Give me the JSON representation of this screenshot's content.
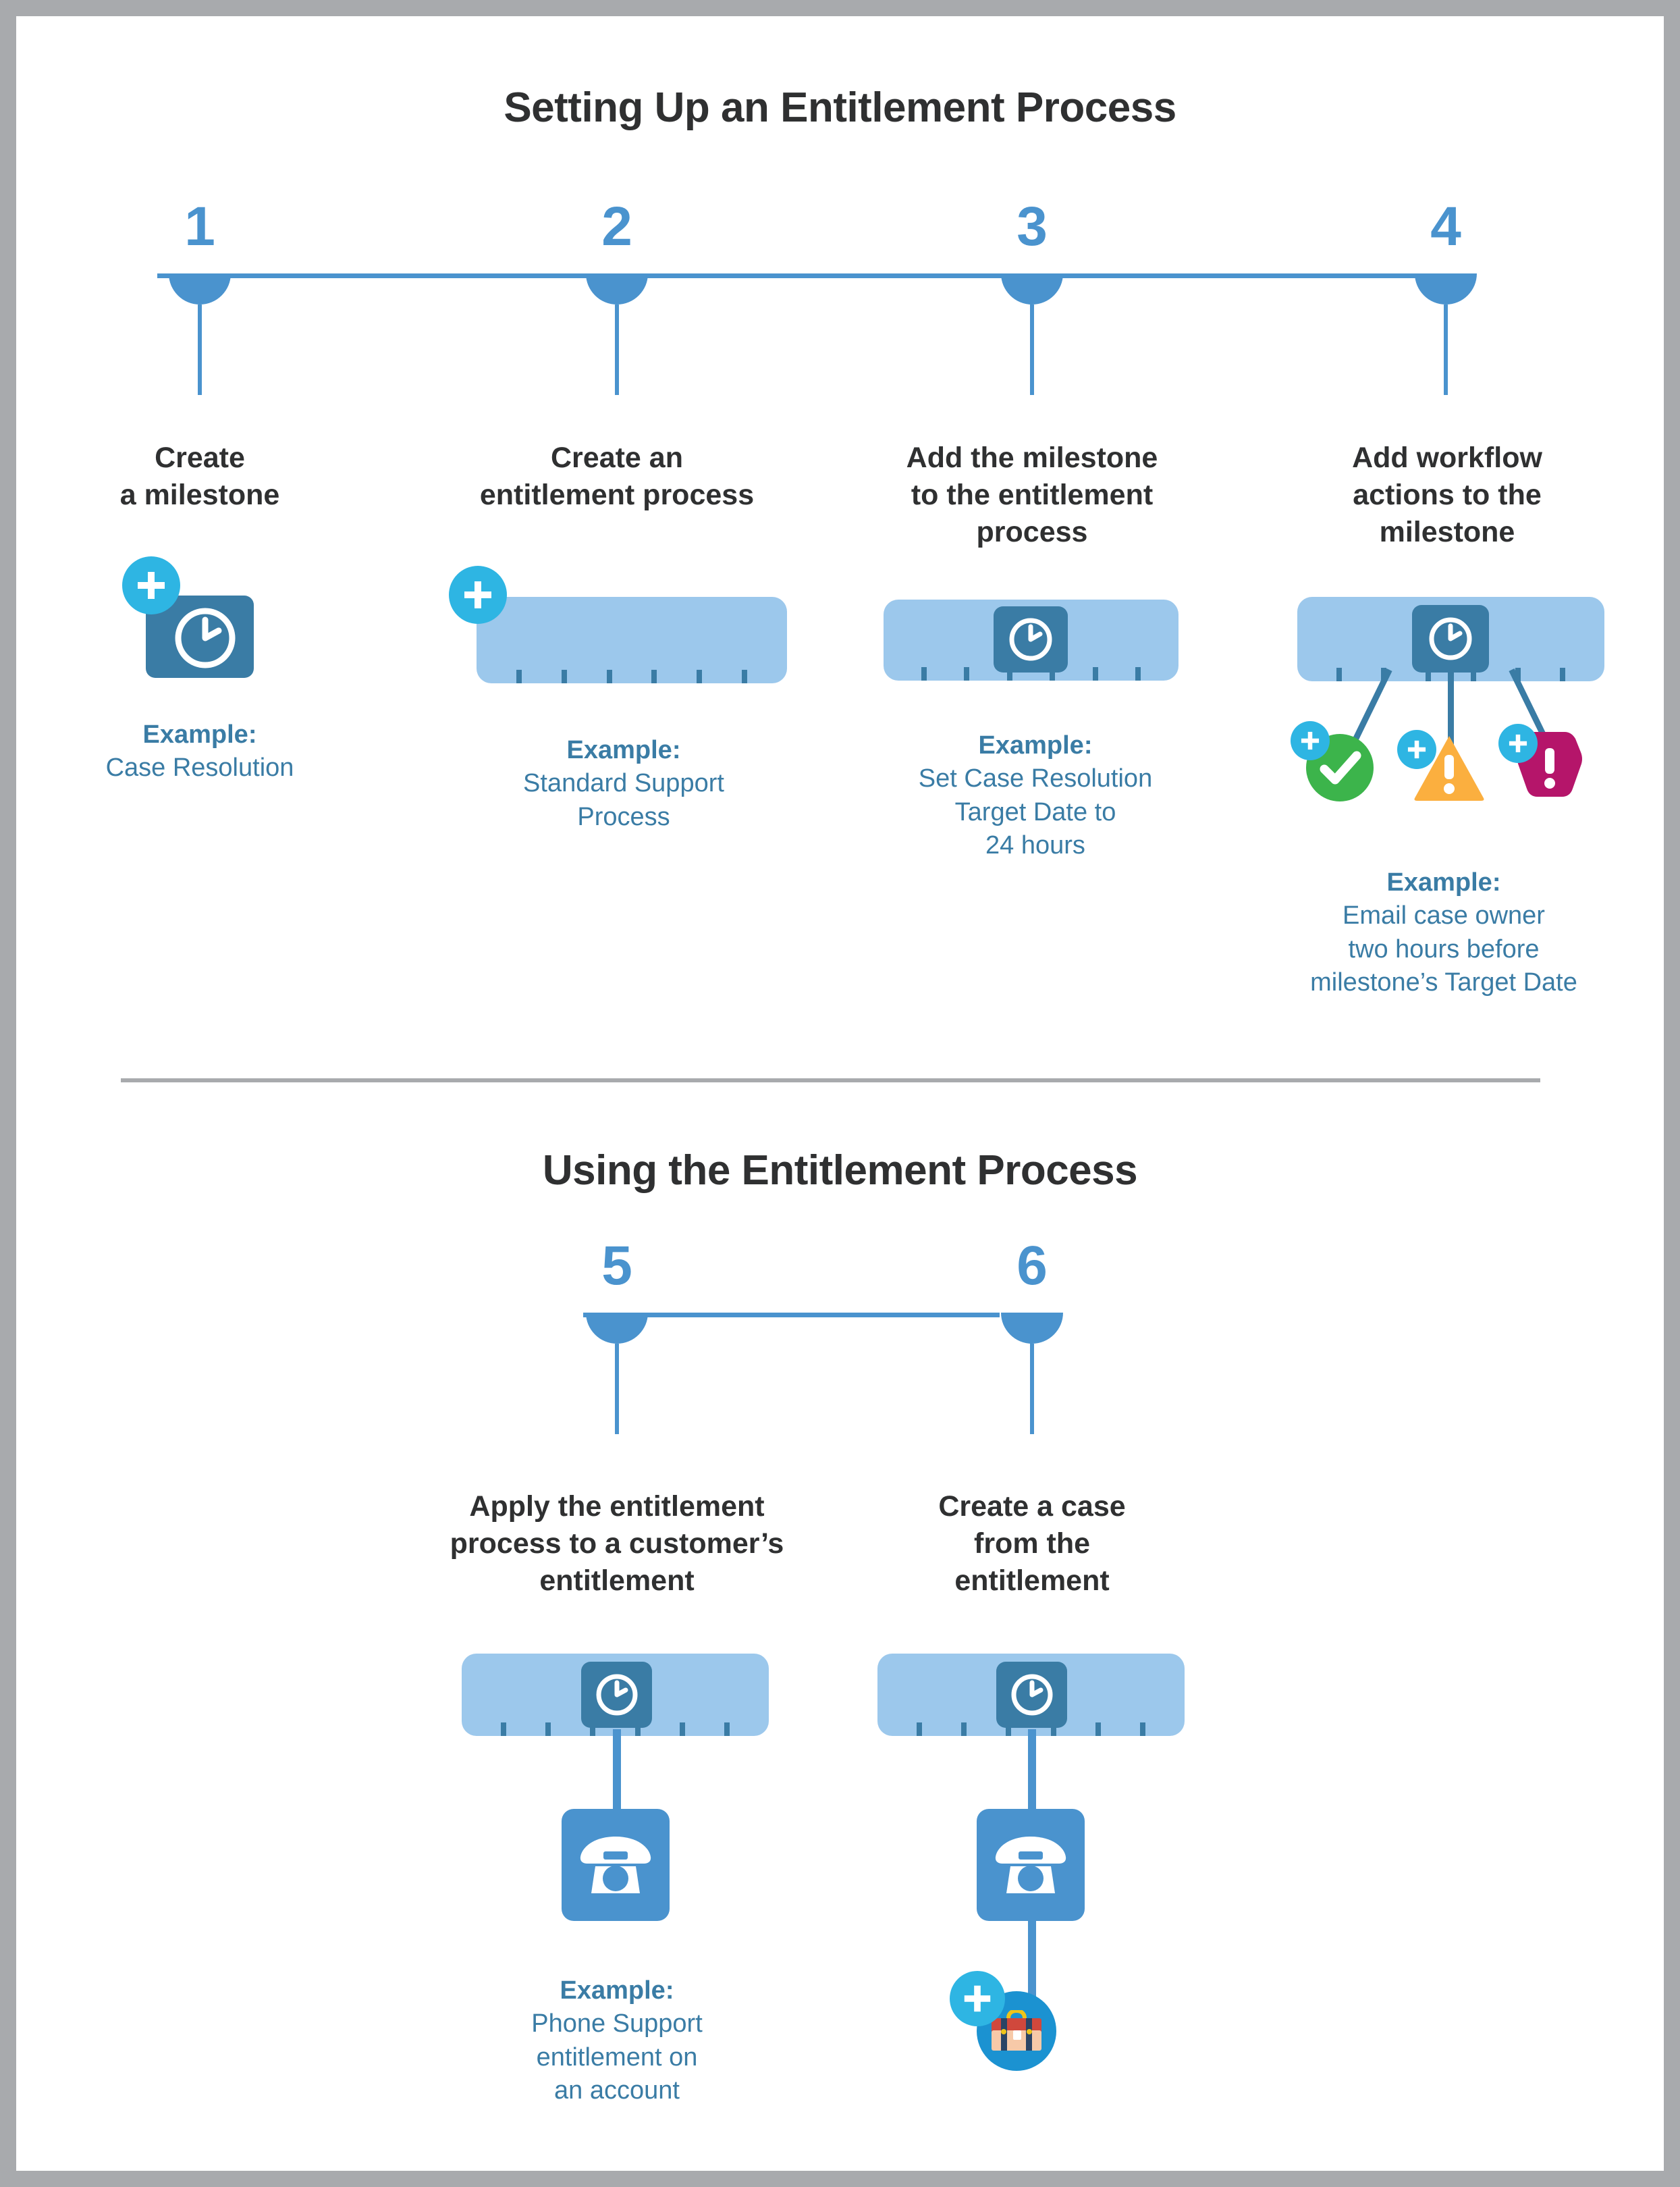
{
  "sections": [
    {
      "id": "setup",
      "title": "Setting Up an Entitlement Process"
    },
    {
      "id": "using",
      "title": "Using the Entitlement Process"
    }
  ],
  "steps": [
    {
      "number": "1",
      "heading": "Create\na milestone",
      "heading_lines": [
        "Create",
        "a milestone"
      ],
      "example_label": "Example:",
      "example_value": "Case Resolution",
      "example_value_lines": [
        "Case Resolution"
      ],
      "icons": [
        "plus-icon",
        "milestone-clock-icon"
      ]
    },
    {
      "number": "2",
      "heading": "Create an\nentitlement process",
      "heading_lines": [
        "Create an",
        "entitlement process"
      ],
      "example_label": "Example:",
      "example_value": "Standard Support Process",
      "example_value_lines": [
        "Standard Support",
        "Process"
      ],
      "icons": [
        "plus-icon",
        "entitlement-process-bar-icon"
      ]
    },
    {
      "number": "3",
      "heading": "Add the milestone\nto the entitlement\nprocess",
      "heading_lines": [
        "Add the milestone",
        "to the entitlement",
        "process"
      ],
      "example_label": "Example:",
      "example_value": "Set Case Resolution Target Date to 24 hours",
      "example_value_lines": [
        "Set Case Resolution",
        "Target Date to",
        "24 hours"
      ],
      "icons": [
        "entitlement-process-bar-icon",
        "milestone-clock-icon"
      ]
    },
    {
      "number": "4",
      "heading": "Add workflow\nactions to the\nmilestone",
      "heading_lines": [
        "Add workflow",
        "actions to the",
        "milestone"
      ],
      "example_label": "Example:",
      "example_value": "Email case owner two hours before milestone’s Target Date",
      "example_value_lines": [
        "Email case owner",
        "two hours before",
        "milestone’s Target Date"
      ],
      "icons": [
        "entitlement-process-bar-icon",
        "milestone-clock-icon",
        "success-check-icon",
        "warning-triangle-icon",
        "alert-hexagon-icon",
        "plus-icon"
      ]
    },
    {
      "number": "5",
      "heading": "Apply the entitlement\nprocess to a customer’s\nentitlement",
      "heading_lines": [
        "Apply the entitlement",
        "process to a customer’s",
        "entitlement"
      ],
      "example_label": "Example:",
      "example_value": "Phone Support entitlement on an account",
      "example_value_lines": [
        "Phone Support",
        "entitlement on",
        "an account"
      ],
      "icons": [
        "entitlement-process-bar-icon",
        "milestone-clock-icon",
        "phone-icon"
      ]
    },
    {
      "number": "6",
      "heading": "Create a case\nfrom the\nentitlement",
      "heading_lines": [
        "Create a case",
        "from the",
        "entitlement"
      ],
      "example_label": "",
      "example_value": "",
      "example_value_lines": [],
      "icons": [
        "entitlement-process-bar-icon",
        "milestone-clock-icon",
        "phone-icon",
        "case-briefcase-icon",
        "plus-icon"
      ]
    }
  ],
  "colors": {
    "timeline_blue": "#4a93ce",
    "dark_blue": "#3a7ca5",
    "light_blue_bar": "#9cc8ec",
    "plus_badge": "#2eb5e3",
    "case_circle": "#1b92d1",
    "success_green": "#3cb44b",
    "warning_orange": "#fbaf3f",
    "alert_magenta": "#b5156a",
    "heading_text": "#2f3031",
    "example_text": "#3a7ca5",
    "page_border": "#a8aaad",
    "page_background": "#ffffff"
  }
}
